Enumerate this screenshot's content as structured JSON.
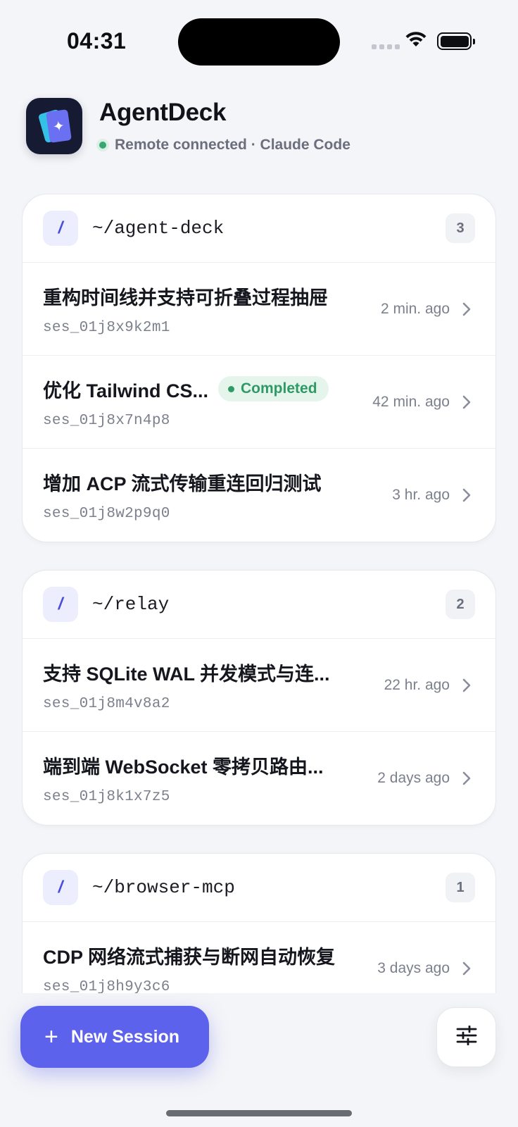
{
  "status_bar": {
    "time": "04:31"
  },
  "header": {
    "title": "AgentDeck",
    "status_text": "Remote connected · Claude Code",
    "status_color": "#35a872",
    "accent": "#5d62ec"
  },
  "groups": [
    {
      "icon": "/",
      "path": "~/agent-deck",
      "count": "3",
      "sessions": [
        {
          "title": "重构时间线并支持可折叠过程抽屉",
          "id": "ses_01j8x9k2m1",
          "time": "2 min. ago",
          "badge": ""
        },
        {
          "title": "优化 Tailwind CS...",
          "id": "ses_01j8x7n4p8",
          "time": "42 min. ago",
          "badge": "Completed"
        },
        {
          "title": "增加 ACP 流式传输重连回归测试",
          "id": "ses_01j8w2p9q0",
          "time": "3 hr. ago",
          "badge": ""
        }
      ]
    },
    {
      "icon": "/",
      "path": "~/relay",
      "count": "2",
      "sessions": [
        {
          "title": "支持 SQLite WAL 并发模式与连...",
          "id": "ses_01j8m4v8a2",
          "time": "22 hr. ago",
          "badge": ""
        },
        {
          "title": "端到端 WebSocket 零拷贝路由...",
          "id": "ses_01j8k1x7z5",
          "time": "2 days ago",
          "badge": ""
        }
      ]
    },
    {
      "icon": "/",
      "path": "~/browser-mcp",
      "count": "1",
      "sessions": [
        {
          "title": "CDP 网络流式捕获与断网自动恢复",
          "id": "ses_01j8h9y3c6",
          "time": "3 days ago",
          "badge": ""
        }
      ]
    }
  ],
  "actions": {
    "new_session_label": "New Session",
    "plus_icon": "+",
    "settings_icon": "sliders-icon"
  }
}
